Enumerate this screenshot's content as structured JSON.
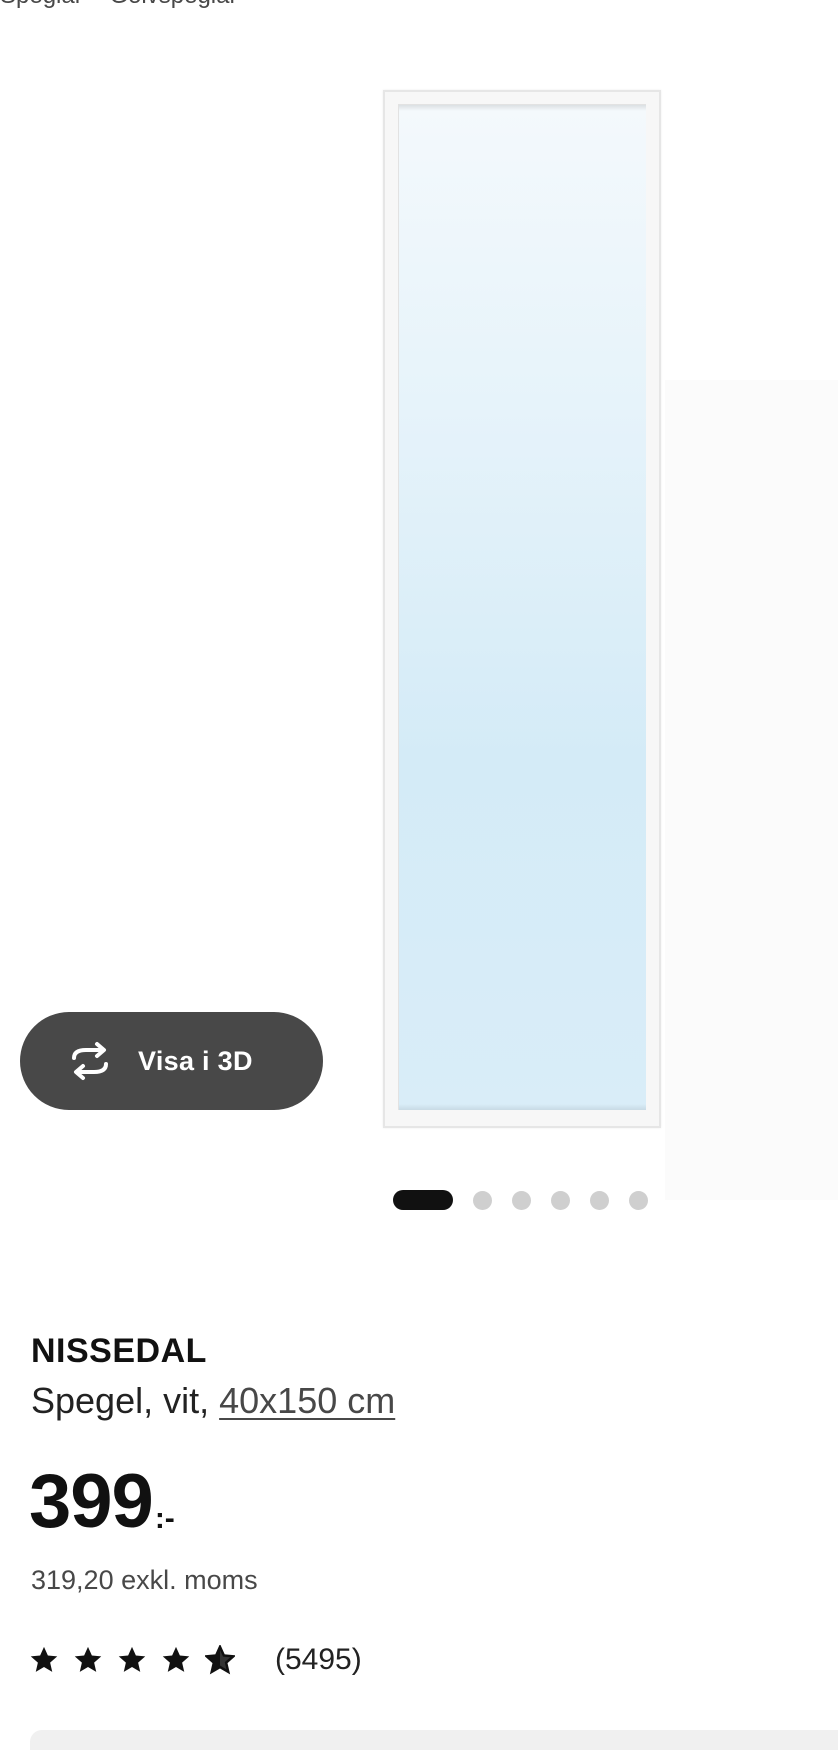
{
  "breadcrumb": {
    "items": [
      "Speglar",
      "Golvspeglar"
    ]
  },
  "media": {
    "view_3d_label": "Visa i 3D",
    "icon": "rotate-3d-icon",
    "carousel_total": 6,
    "carousel_active": 1
  },
  "product": {
    "name": "NISSEDAL",
    "description": "Spegel, vit,",
    "size": "40x150 cm",
    "price_amount": "399",
    "price_suffix": ":-",
    "price_excl": "319,20 exkl. moms",
    "rating_stars": 4.5,
    "rating_count": "(5495)"
  },
  "colors": {
    "button_bg": "#484848",
    "text": "#111111",
    "dot_active": "#111111",
    "dot_inactive": "#cfcfcf"
  }
}
